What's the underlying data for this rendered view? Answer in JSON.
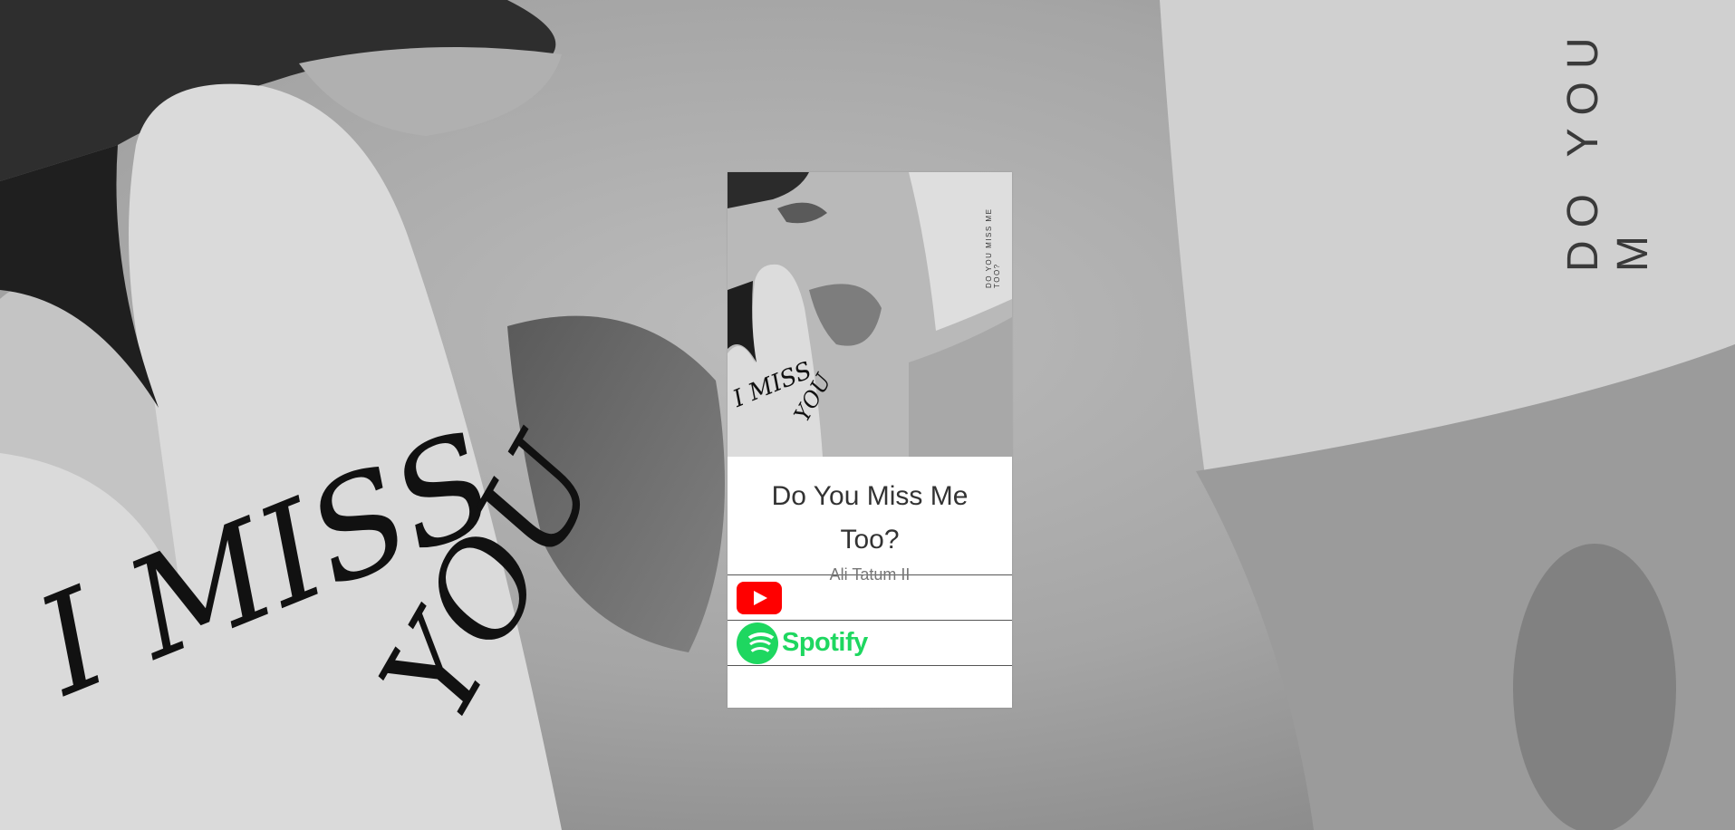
{
  "background": {
    "cover_text_vertical": "DO YOU M",
    "handwriting_line1": "I MISS",
    "handwriting_line2": "YOU"
  },
  "album": {
    "cover_side_text": "DO YOU MISS ME TOO?",
    "cover_hand_line1": "I MISS",
    "cover_hand_line2": "YOU",
    "title": "Do You Miss Me Too?",
    "artist": "Ali Tatum II"
  },
  "links": {
    "youtube": {
      "icon": "youtube-play-icon",
      "color": "#ff0000"
    },
    "spotify": {
      "icon": "spotify-logo-icon",
      "wordmark": "Spotify",
      "color": "#1ed760"
    }
  }
}
